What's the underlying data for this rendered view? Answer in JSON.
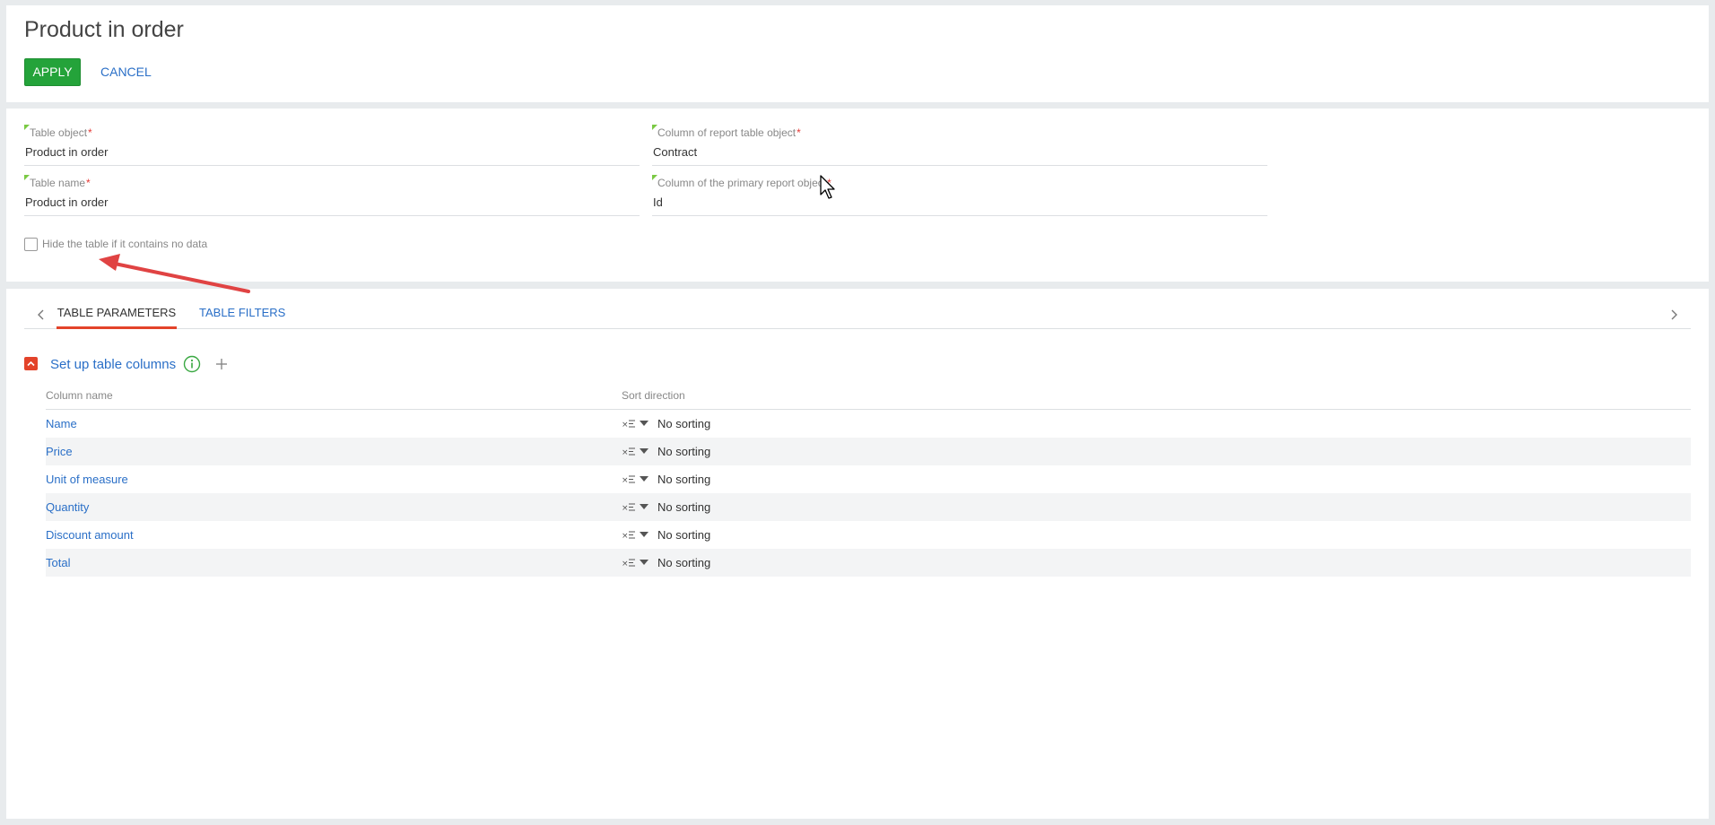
{
  "header": {
    "title": "Product in order",
    "apply_label": "APPLY",
    "cancel_label": "CANCEL"
  },
  "form": {
    "table_object": {
      "label": "Table object",
      "required": "*",
      "value": "Product in order"
    },
    "table_name": {
      "label": "Table name",
      "required": "*",
      "value": "Product in order"
    },
    "report_column": {
      "label": "Column of report table object",
      "required": "*",
      "value": "Contract"
    },
    "primary_column": {
      "label": "Column of the primary report object",
      "required": "*",
      "value": "Id"
    },
    "hide_checkbox": {
      "label": "Hide the table if it contains no data",
      "checked": false
    }
  },
  "tabs": [
    {
      "label": "TABLE PARAMETERS",
      "active": true
    },
    {
      "label": "TABLE FILTERS",
      "active": false
    }
  ],
  "group": {
    "title": "Set up table columns",
    "info_icon": "info-circle-icon",
    "add_icon": "plus-icon"
  },
  "table": {
    "headers": [
      "Column name",
      "Sort direction"
    ],
    "rows": [
      {
        "name": "Name",
        "sort": "No sorting"
      },
      {
        "name": "Price",
        "sort": "No sorting"
      },
      {
        "name": "Unit of measure",
        "sort": "No sorting"
      },
      {
        "name": "Quantity",
        "sort": "No sorting"
      },
      {
        "name": "Discount amount",
        "sort": "No sorting"
      },
      {
        "name": "Total",
        "sort": "No sorting"
      }
    ]
  },
  "colors": {
    "apply_bg": "#24a33a",
    "link": "#2a6fc7",
    "accent": "#e3432a",
    "required": "#e53935",
    "field_marker": "#7ac943",
    "annotation_arrow": "#e04343"
  }
}
